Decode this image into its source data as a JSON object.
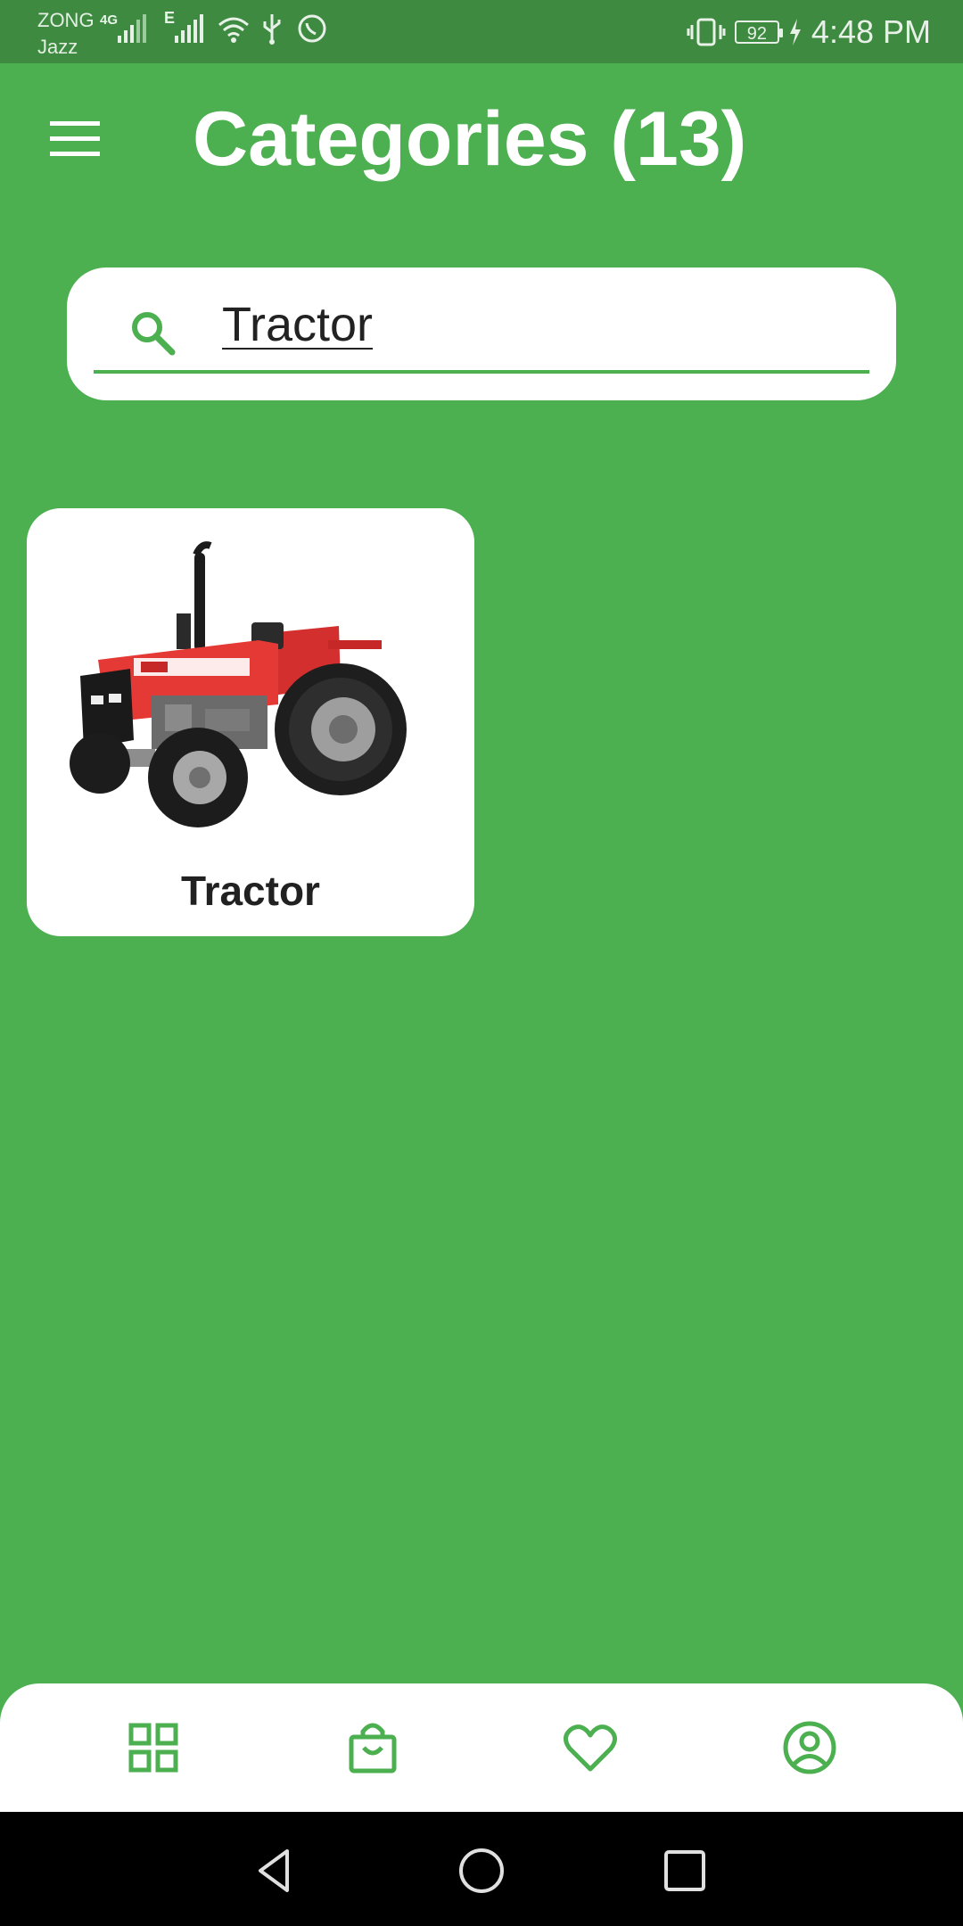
{
  "status_bar": {
    "carrier_1": "ZONG",
    "network_1": "4G",
    "carrier_2": "Jazz",
    "network_2": "E",
    "battery_level": "92",
    "time": "4:48 PM",
    "icons": [
      "signal-icon",
      "wifi-icon",
      "usb-icon",
      "whatsapp-icon",
      "vibrate-icon",
      "battery-icon",
      "charging-icon"
    ]
  },
  "app_bar": {
    "title": "Categories (13)",
    "menu_icon": "hamburger-menu-icon"
  },
  "search": {
    "value": "Tractor",
    "icon": "search-icon"
  },
  "categories": [
    {
      "label": "Tractor",
      "image": "tractor-image"
    }
  ],
  "bottom_nav": {
    "items": [
      "categories-grid-icon",
      "shopping-bag-icon",
      "heart-icon",
      "account-icon"
    ]
  },
  "system_nav": {
    "items": [
      "back-icon",
      "home-icon",
      "recents-icon"
    ]
  },
  "colors": {
    "primary": "#4caf50",
    "status_bar": "#3e8a41",
    "card": "#ffffff",
    "text_dark": "#212121"
  }
}
